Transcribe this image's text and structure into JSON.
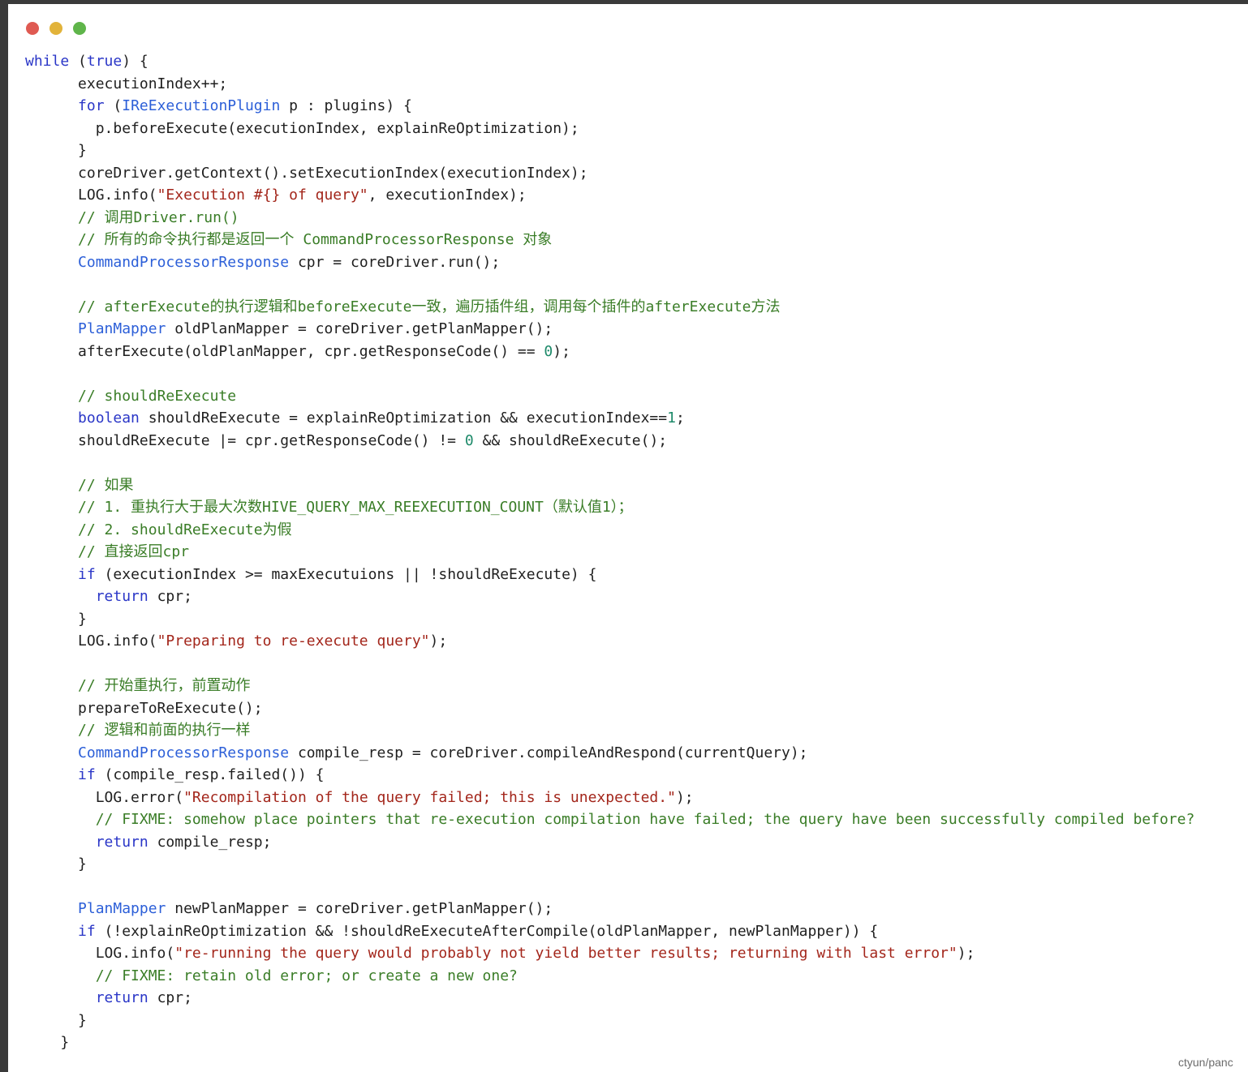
{
  "window": {
    "controls": {
      "close_color": "#df5a52",
      "minimize_color": "#e2b33a",
      "maximize_color": "#5fb54a"
    }
  },
  "colors": {
    "keyword": "#2a36c7",
    "type": "#2c5fd8",
    "string": "#a3261b",
    "number": "#1e8a6a",
    "comment": "#3a7d27",
    "plain": "#1f1f1f"
  },
  "code_lines": [
    [
      [
        "kw",
        "while"
      ],
      [
        "plain",
        " ("
      ],
      [
        "kw",
        "true"
      ],
      [
        "plain",
        ") {"
      ]
    ],
    [
      [
        "plain",
        "      executionIndex++;"
      ]
    ],
    [
      [
        "plain",
        "      "
      ],
      [
        "kw",
        "for"
      ],
      [
        "plain",
        " ("
      ],
      [
        "type",
        "IReExecutionPlugin"
      ],
      [
        "plain",
        " p : plugins) {"
      ]
    ],
    [
      [
        "plain",
        "        p.beforeExecute(executionIndex, explainReOptimization);"
      ]
    ],
    [
      [
        "plain",
        "      }"
      ]
    ],
    [
      [
        "plain",
        "      coreDriver.getContext().setExecutionIndex(executionIndex);"
      ]
    ],
    [
      [
        "plain",
        "      LOG.info("
      ],
      [
        "str",
        "\"Execution #{} of query\""
      ],
      [
        "plain",
        ", executionIndex);"
      ]
    ],
    [
      [
        "plain",
        "      "
      ],
      [
        "cm",
        "// 调用Driver.run()"
      ]
    ],
    [
      [
        "plain",
        "      "
      ],
      [
        "cm",
        "// 所有的命令执行都是返回一个 CommandProcessorResponse 对象"
      ]
    ],
    [
      [
        "plain",
        "      "
      ],
      [
        "type",
        "CommandProcessorResponse"
      ],
      [
        "plain",
        " cpr = coreDriver.run();"
      ]
    ],
    [
      [
        "plain",
        ""
      ]
    ],
    [
      [
        "plain",
        "      "
      ],
      [
        "cm",
        "// afterExecute的执行逻辑和beforeExecute一致，遍历插件组，调用每个插件的afterExecute方法"
      ]
    ],
    [
      [
        "plain",
        "      "
      ],
      [
        "type",
        "PlanMapper"
      ],
      [
        "plain",
        " oldPlanMapper = coreDriver.getPlanMapper();"
      ]
    ],
    [
      [
        "plain",
        "      afterExecute(oldPlanMapper, cpr.getResponseCode() == "
      ],
      [
        "num",
        "0"
      ],
      [
        "plain",
        ");"
      ]
    ],
    [
      [
        "plain",
        ""
      ]
    ],
    [
      [
        "plain",
        "      "
      ],
      [
        "cm",
        "// shouldReExecute"
      ]
    ],
    [
      [
        "plain",
        "      "
      ],
      [
        "kw",
        "boolean"
      ],
      [
        "plain",
        " shouldReExecute = explainReOptimization && executionIndex=="
      ],
      [
        "num",
        "1"
      ],
      [
        "plain",
        ";"
      ]
    ],
    [
      [
        "plain",
        "      shouldReExecute |= cpr.getResponseCode() != "
      ],
      [
        "num",
        "0"
      ],
      [
        "plain",
        " && shouldReExecute();"
      ]
    ],
    [
      [
        "plain",
        ""
      ]
    ],
    [
      [
        "plain",
        "      "
      ],
      [
        "cm",
        "// 如果"
      ]
    ],
    [
      [
        "plain",
        "      "
      ],
      [
        "cm",
        "// 1. 重执行大于最大次数HIVE_QUERY_MAX_REEXECUTION_COUNT（默认值1）；"
      ]
    ],
    [
      [
        "plain",
        "      "
      ],
      [
        "cm",
        "// 2. shouldReExecute为假"
      ]
    ],
    [
      [
        "plain",
        "      "
      ],
      [
        "cm",
        "// 直接返回cpr"
      ]
    ],
    [
      [
        "plain",
        "      "
      ],
      [
        "kw",
        "if"
      ],
      [
        "plain",
        " (executionIndex >= maxExecutuions || !shouldReExecute) {"
      ]
    ],
    [
      [
        "plain",
        "        "
      ],
      [
        "kw",
        "return"
      ],
      [
        "plain",
        " cpr;"
      ]
    ],
    [
      [
        "plain",
        "      }"
      ]
    ],
    [
      [
        "plain",
        "      LOG.info("
      ],
      [
        "str",
        "\"Preparing to re-execute query\""
      ],
      [
        "plain",
        ");"
      ]
    ],
    [
      [
        "plain",
        ""
      ]
    ],
    [
      [
        "plain",
        "      "
      ],
      [
        "cm",
        "// 开始重执行，前置动作"
      ]
    ],
    [
      [
        "plain",
        "      prepareToReExecute();"
      ]
    ],
    [
      [
        "plain",
        "      "
      ],
      [
        "cm",
        "// 逻辑和前面的执行一样"
      ]
    ],
    [
      [
        "plain",
        "      "
      ],
      [
        "type",
        "CommandProcessorResponse"
      ],
      [
        "plain",
        " compile_resp = coreDriver.compileAndRespond(currentQuery);"
      ]
    ],
    [
      [
        "plain",
        "      "
      ],
      [
        "kw",
        "if"
      ],
      [
        "plain",
        " (compile_resp.failed()) {"
      ]
    ],
    [
      [
        "plain",
        "        LOG.error("
      ],
      [
        "str",
        "\"Recompilation of the query failed; this is unexpected.\""
      ],
      [
        "plain",
        ");"
      ]
    ],
    [
      [
        "plain",
        "        "
      ],
      [
        "cm",
        "// FIXME: somehow place pointers that re-execution compilation have failed; the query have been successfully compiled before?"
      ]
    ],
    [
      [
        "plain",
        "        "
      ],
      [
        "kw",
        "return"
      ],
      [
        "plain",
        " compile_resp;"
      ]
    ],
    [
      [
        "plain",
        "      }"
      ]
    ],
    [
      [
        "plain",
        ""
      ]
    ],
    [
      [
        "plain",
        "      "
      ],
      [
        "type",
        "PlanMapper"
      ],
      [
        "plain",
        " newPlanMapper = coreDriver.getPlanMapper();"
      ]
    ],
    [
      [
        "plain",
        "      "
      ],
      [
        "kw",
        "if"
      ],
      [
        "plain",
        " (!explainReOptimization && !shouldReExecuteAfterCompile(oldPlanMapper, newPlanMapper)) {"
      ]
    ],
    [
      [
        "plain",
        "        LOG.info("
      ],
      [
        "str",
        "\"re-running the query would probably not yield better results; returning with last error\""
      ],
      [
        "plain",
        ");"
      ]
    ],
    [
      [
        "plain",
        "        "
      ],
      [
        "cm",
        "// FIXME: retain old error; or create a new one?"
      ]
    ],
    [
      [
        "plain",
        "        "
      ],
      [
        "kw",
        "return"
      ],
      [
        "plain",
        " cpr;"
      ]
    ],
    [
      [
        "plain",
        "      }"
      ]
    ],
    [
      [
        "plain",
        "    }"
      ]
    ]
  ],
  "watermark": "ctyun/panc"
}
